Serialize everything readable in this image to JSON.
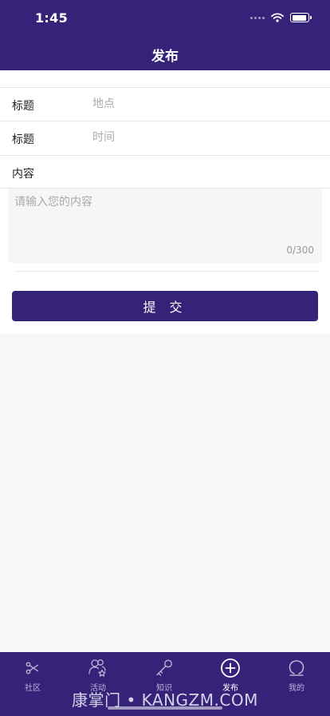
{
  "status_bar": {
    "time": "1:45"
  },
  "nav": {
    "title": "发布"
  },
  "form": {
    "location": {
      "label": "标题",
      "placeholder": "地点",
      "value": ""
    },
    "time": {
      "label": "标题",
      "placeholder": "时间",
      "value": ""
    },
    "content": {
      "label": "内容",
      "placeholder": "请输入您的内容",
      "value": "",
      "counter": "0/300"
    },
    "submit_label": "提 交"
  },
  "tabs": [
    {
      "label": "社区",
      "icon": "scissors-icon",
      "active": false
    },
    {
      "label": "活动",
      "icon": "people-star-icon",
      "active": false
    },
    {
      "label": "知识",
      "icon": "key-icon",
      "active": false
    },
    {
      "label": "发布",
      "icon": "plus-circle-icon",
      "active": true
    },
    {
      "label": "我的",
      "icon": "person-icon",
      "active": false
    }
  ],
  "watermark": "康掌门 • KANGZM.COM",
  "colors": {
    "primary": "#35237a",
    "background": "#f7f7f7"
  }
}
